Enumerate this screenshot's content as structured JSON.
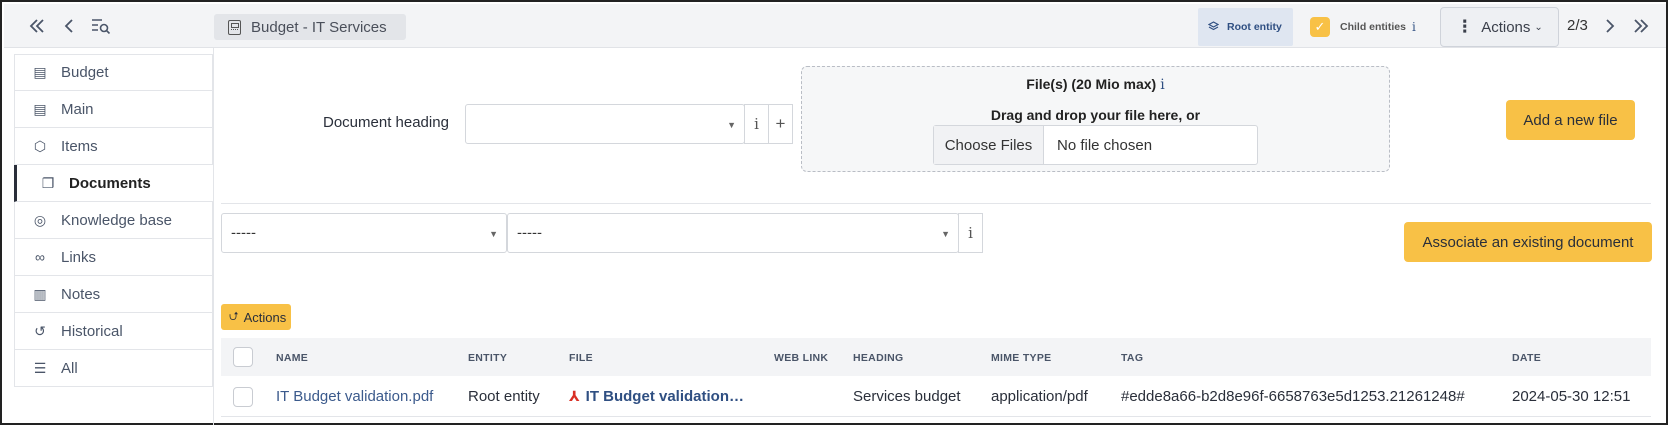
{
  "topbar": {
    "collapse_icon": "double-chevron-left-icon",
    "back_icon": "chevron-left-icon",
    "search_list_icon": "list-search-icon",
    "breadcrumb": "Budget -  IT Services",
    "root_entity_label": "Root entity",
    "child_entities_label": "Child entities",
    "actions_label": "Actions",
    "pager": "2/3"
  },
  "sidebar": {
    "items": [
      {
        "label": "Budget",
        "icon": "calculator-icon"
      },
      {
        "label": "Main",
        "icon": "calculator-icon"
      },
      {
        "label": "Items",
        "icon": "cube-icon"
      },
      {
        "label": "Documents",
        "icon": "documents-icon"
      },
      {
        "label": "Knowledge base",
        "icon": "lifebuoy-icon"
      },
      {
        "label": "Links",
        "icon": "link-icon"
      },
      {
        "label": "Notes",
        "icon": "note-icon"
      },
      {
        "label": "Historical",
        "icon": "history-icon"
      },
      {
        "label": "All",
        "icon": "stack-icon"
      }
    ],
    "active_index": 3
  },
  "form": {
    "document_heading_label": "Document heading",
    "document_heading_value": "",
    "dropzone_title": "File(s) (20 Mio max)",
    "dropzone_subtitle": "Drag and drop your file here, or",
    "choose_files_label": "Choose Files",
    "no_file_label": "No file chosen",
    "add_file_button": "Add a new file",
    "filter_1_value": "-----",
    "filter_2_value": "-----",
    "associate_button": "Associate an existing document",
    "mini_actions_label": "Actions"
  },
  "table": {
    "columns": [
      "NAME",
      "ENTITY",
      "FILE",
      "WEB LINK",
      "HEADING",
      "MIME TYPE",
      "TAG",
      "DATE"
    ],
    "rows": [
      {
        "name": "IT Budget validation.pdf",
        "entity": "Root entity",
        "file": "IT Budget validation…",
        "web_link": "",
        "heading": "Services budget",
        "mime_type": "application/pdf",
        "tag": "#edde8a66-b2d8e96f-6658763e5d1253.21261248#",
        "date": "2024-05-30 12:51"
      }
    ]
  },
  "colors": {
    "accent_yellow": "#f8c146",
    "root_entity_bg": "#dfe6f1",
    "link_blue": "#2f4f82"
  }
}
